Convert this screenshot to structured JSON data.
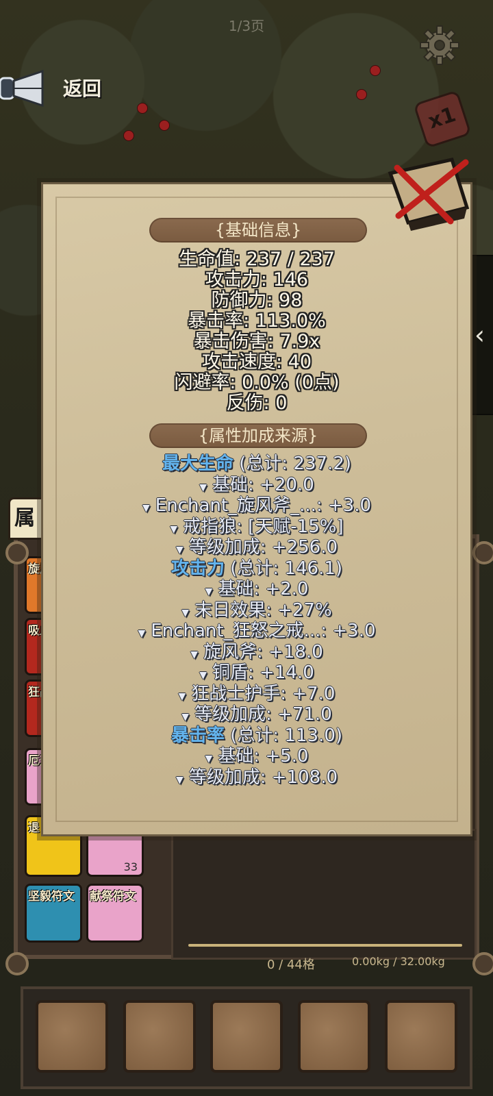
{
  "header": {
    "page_indicator": "1/3页",
    "back_label": "返回",
    "speed_label": "x1"
  },
  "base_info": {
    "title": "{基础信息}",
    "lines": [
      "生命值: 237 / 237",
      "攻击力: 146",
      "防御力: 98",
      "暴击率: 113.0%",
      "暴击伤害: 7.9x",
      "攻击速度: 40",
      "闪避率: 0.0% (0点)",
      "反伤: 0"
    ]
  },
  "bonus_sources": {
    "title": "{属性加成来源}",
    "groups": [
      {
        "key": "最大生命",
        "total": " (总计: 237.2)",
        "items": [
          "基础: +20.0",
          "Enchant_旋风斧_...: +3.0",
          "戒指狼: [天赋-15%]",
          "等级加成: +256.0"
        ]
      },
      {
        "key": "攻击力",
        "total": " (总计: 146.1)",
        "items": [
          "基础: +2.0",
          "末日效果: +27%",
          "Enchant_狂怒之戒...: +3.0",
          "旋风斧: +18.0",
          "铜盾: +14.0",
          "狂战士护手: +7.0",
          "等级加成: +71.0"
        ]
      },
      {
        "key": "暴击率",
        "total": " (总计: 113.0)",
        "items": [
          "基础: +5.0",
          "等级加成: +108.0"
        ]
      }
    ]
  },
  "inventory": {
    "attr_tab_label": "属",
    "tiles": [
      {
        "label": "旋风",
        "color": "#e0782a"
      },
      {
        "label": "吸血",
        "color": "#b3281e"
      },
      {
        "label": "狂战",
        "color": "#b3281e"
      },
      {
        "label": "厄运",
        "color": "#e9a3c9"
      },
      {
        "label": "退",
        "color": "#f0c419"
      },
      {
        "label": "",
        "count": "33",
        "color": "#e9a3c9"
      },
      {
        "label": "坚毅符文",
        "color": "#2e8fb0"
      },
      {
        "label": "献祭符文",
        "color": "#e9a3c9"
      }
    ],
    "capacity": "0 / 44格",
    "weight": "0.00kg / 32.00kg"
  },
  "side_tab_icon": "chevron-left-icon"
}
